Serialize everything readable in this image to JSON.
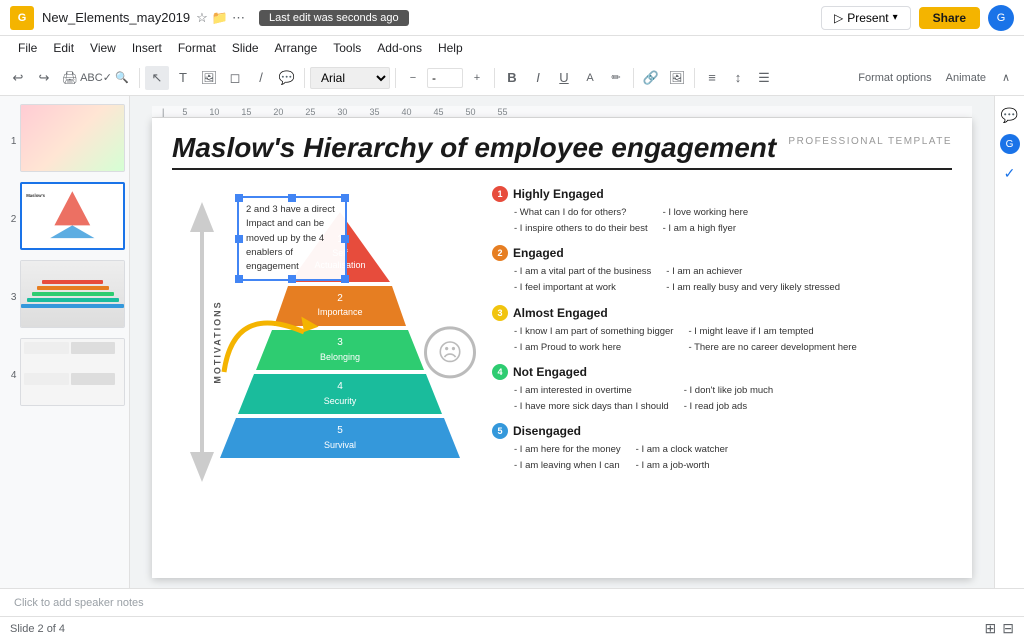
{
  "app": {
    "title": "New_Elements_may2019",
    "icon_label": "G",
    "toast": "Last edit was seconds ago"
  },
  "topbar": {
    "title": "New_Elements_may2019",
    "present_label": "Present",
    "share_label": "Share",
    "avatar_initials": "G"
  },
  "menu": {
    "items": [
      "File",
      "Edit",
      "View",
      "Insert",
      "Format",
      "Slide",
      "Arrange",
      "Tools",
      "Add-ons",
      "Help"
    ]
  },
  "toolbar": {
    "font_name": "Arial",
    "font_size": "-",
    "format_options_label": "Format options",
    "animate_label": "Animate"
  },
  "slide": {
    "title": "Maslow's Hierarchy of employee engagement",
    "pro_template": "PROFESSIONAL TEMPLATE",
    "textbox": "2 and 3 have a direct Impact and can be moved up by the 4 enablers of engagement",
    "motivations": "MOTIVATIONS"
  },
  "pyramid": {
    "levels": [
      {
        "num": "1",
        "label": "Self\nActualisation",
        "color": "#e74c3c"
      },
      {
        "num": "2",
        "label": "Importance",
        "color": "#e67e22"
      },
      {
        "num": "3",
        "label": "Belonging",
        "color": "#2ecc71"
      },
      {
        "num": "4",
        "label": "Security",
        "color": "#1abc9c"
      },
      {
        "num": "5",
        "label": "Survival",
        "color": "#3498db"
      }
    ]
  },
  "engagement": [
    {
      "num": "1",
      "color": "#e74c3c",
      "title": "Highly Engaged",
      "col1": [
        "- What can I do for others?",
        "- I inspire others to do their best"
      ],
      "col2": [
        "- I love working here",
        "- I am a high flyer"
      ]
    },
    {
      "num": "2",
      "color": "#e67e22",
      "title": "Engaged",
      "col1": [
        "- I am a vital part of the business",
        "- I feel important at work"
      ],
      "col2": [
        "- I am an achiever",
        "- I am really busy and very likely stressed"
      ]
    },
    {
      "num": "3",
      "color": "#f1c40f",
      "title": "Almost Engaged",
      "col1": [
        "- I know I am part of something bigger",
        "- I am Proud to work here"
      ],
      "col2": [
        "- I might leave if I am tempted",
        "- There are no career development here"
      ]
    },
    {
      "num": "4",
      "color": "#2ecc71",
      "title": "Not Engaged",
      "col1": [
        "- I am interested in overtime",
        "- I have more sick days than I should"
      ],
      "col2": [
        "- I don't like job much",
        "- I read job ads"
      ]
    },
    {
      "num": "5",
      "color": "#3498db",
      "title": "Disengaged",
      "col1": [
        "- I am here for the money",
        "- I am leaving when I can"
      ],
      "col2": [
        "- I am a clock watcher",
        "- I am a job-worth"
      ]
    }
  ],
  "slides": [
    {
      "num": "1",
      "active": false
    },
    {
      "num": "2",
      "active": true
    },
    {
      "num": "3",
      "active": false
    },
    {
      "num": "4",
      "active": false
    }
  ],
  "notes": {
    "placeholder": "Click to add speaker notes"
  },
  "bottom": {
    "slide_info": "Slide 2 of 4"
  }
}
